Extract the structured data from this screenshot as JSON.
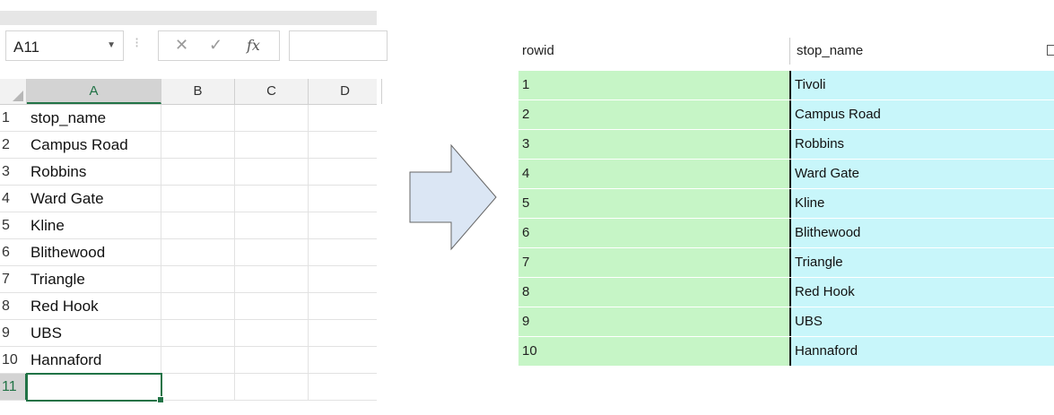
{
  "excel": {
    "name_box": "A11",
    "formula_buttons": {
      "cancel": "✕",
      "enter": "✓",
      "fx": "fx"
    },
    "columns": [
      "A",
      "B",
      "C",
      "D"
    ],
    "selected_column": "A",
    "rows": [
      {
        "num": "1",
        "a": "stop_name"
      },
      {
        "num": "2",
        "a": "Campus Road"
      },
      {
        "num": "3",
        "a": "Robbins"
      },
      {
        "num": "4",
        "a": "Ward Gate"
      },
      {
        "num": "5",
        "a": "Kline"
      },
      {
        "num": "6",
        "a": "Blithewood"
      },
      {
        "num": "7",
        "a": "Triangle"
      },
      {
        "num": "8",
        "a": "Red Hook"
      },
      {
        "num": "9",
        "a": "UBS"
      },
      {
        "num": "10",
        "a": "Hannaford"
      },
      {
        "num": "11",
        "a": ""
      }
    ],
    "active_row": "11",
    "colors": {
      "accent": "#217346"
    }
  },
  "arrow": {
    "fill": "#dbe6f4",
    "stroke": "#666666"
  },
  "table": {
    "headers": {
      "rowid": "rowid",
      "stop_name": "stop_name"
    },
    "rows": [
      {
        "rowid": "1",
        "stop_name": "Tivoli"
      },
      {
        "rowid": "2",
        "stop_name": "Campus Road"
      },
      {
        "rowid": "3",
        "stop_name": "Robbins"
      },
      {
        "rowid": "4",
        "stop_name": "Ward Gate"
      },
      {
        "rowid": "5",
        "stop_name": "Kline"
      },
      {
        "rowid": "6",
        "stop_name": "Blithewood"
      },
      {
        "rowid": "7",
        "stop_name": "Triangle"
      },
      {
        "rowid": "8",
        "stop_name": "Red Hook"
      },
      {
        "rowid": "9",
        "stop_name": "UBS"
      },
      {
        "rowid": "10",
        "stop_name": "Hannaford"
      }
    ],
    "colors": {
      "rowid_bg": "#c6f5c6",
      "stop_bg": "#c8f6fa"
    }
  }
}
